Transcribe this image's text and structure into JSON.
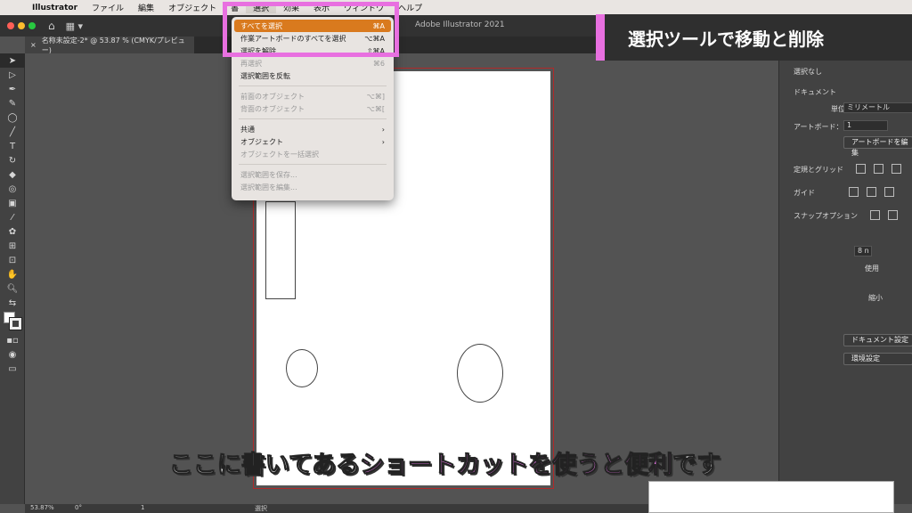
{
  "menubar": {
    "app": "Illustrator",
    "items": [
      "ファイル",
      "編集",
      "オブジェクト",
      "書",
      "選択",
      "効果",
      "表示",
      "ウィンドウ",
      "ヘルプ"
    ],
    "active_item": "選択"
  },
  "window": {
    "title": "Adobe Illustrator 2021",
    "doc_tab": "名称未設定-2* @ 53.87 % (CMYK/プレビュー)"
  },
  "select_menu": {
    "items": [
      {
        "label": "すべてを選択",
        "shortcut": "⌘A",
        "state": "highlighted"
      },
      {
        "label": "作業アートボードのすべてを選択",
        "shortcut": "⌥⌘A",
        "state": "normal"
      },
      {
        "label": "選択を解除",
        "shortcut": "⇧⌘A",
        "state": "normal"
      },
      {
        "label": "再選択",
        "shortcut": "⌘6",
        "state": "disabled"
      },
      {
        "label": "選択範囲を反転",
        "shortcut": "",
        "state": "normal"
      },
      {
        "label": "前面のオブジェクト",
        "shortcut": "⌥⌘]",
        "state": "disabled"
      },
      {
        "label": "背面のオブジェクト",
        "shortcut": "⌥⌘[",
        "state": "disabled"
      },
      {
        "label": "共通",
        "shortcut": "›",
        "state": "normal"
      },
      {
        "label": "オブジェクト",
        "shortcut": "›",
        "state": "normal"
      },
      {
        "label": "オブジェクトを一括選択",
        "shortcut": "",
        "state": "disabled"
      },
      {
        "label": "選択範囲を保存...",
        "shortcut": "",
        "state": "disabled"
      },
      {
        "label": "選択範囲を編集...",
        "shortcut": "",
        "state": "disabled"
      }
    ]
  },
  "properties_panel": {
    "selection": "選択なし",
    "document_label": "ドキュメント",
    "unit_label": "単位：",
    "unit_value": "ミリメートル",
    "artboard_label": "アートボード：",
    "artboard_value": "1",
    "edit_artboard_button": "アートボードを編集",
    "ruler_grid_label": "定規とグリッド",
    "guides_label": "ガイド",
    "snap_label": "スナップオプション",
    "partial_value": "8 n",
    "use_label": "使用",
    "shrink_label": "縮小",
    "doc_setup_button": "ドキュメント設定",
    "prefs_button": "環境設定"
  },
  "statusbar": {
    "zoom": "53.87%",
    "rotation": "0°",
    "artboard": "1",
    "tool": "選択"
  },
  "overlay": {
    "banner": "選択ツールで移動と削除",
    "caption_pre": "ここに書いてある",
    "caption_highlight": "ショートカットを使うと便利",
    "caption_post": "です"
  },
  "colors": {
    "accent_pink": "#e870e0",
    "menu_highlight": "#d97a1e",
    "panel_bg": "#424242",
    "canvas_bg": "#535353"
  }
}
